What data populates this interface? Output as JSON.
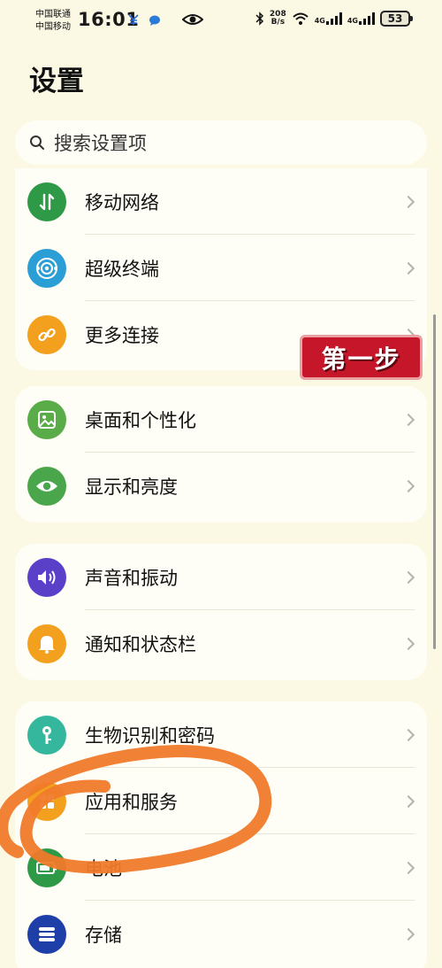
{
  "status_bar": {
    "carrier1": "中国联通",
    "carrier2": "中国移动",
    "time": "16:01",
    "net_speed_value": "208",
    "net_speed_unit": "B/s",
    "signal1_label": "4G",
    "signal2_label": "4G",
    "battery": "53"
  },
  "header": {
    "title": "设置"
  },
  "search": {
    "placeholder": "搜索设置项"
  },
  "groups": [
    {
      "items": [
        {
          "label": "移动网络",
          "icon": "mobile-data-icon",
          "color": "#2e9a48"
        },
        {
          "label": "超级终端",
          "icon": "super-device-icon",
          "color": "#2b9ed6"
        },
        {
          "label": "更多连接",
          "icon": "link-icon",
          "color": "#f2a01e"
        }
      ]
    },
    {
      "items": [
        {
          "label": "桌面和个性化",
          "icon": "wallpaper-icon",
          "color": "#5aac48"
        },
        {
          "label": "显示和亮度",
          "icon": "eye-icon",
          "color": "#4aa64a"
        }
      ]
    },
    {
      "items": [
        {
          "label": "声音和振动",
          "icon": "speaker-icon",
          "color": "#5a3fc9"
        },
        {
          "label": "通知和状态栏",
          "icon": "bell-icon",
          "color": "#f2a01e"
        }
      ]
    },
    {
      "items": [
        {
          "label": "生物识别和密码",
          "icon": "key-icon",
          "color": "#35b79e"
        },
        {
          "label": "应用和服务",
          "icon": "apps-icon",
          "color": "#f2a01e"
        },
        {
          "label": "电池",
          "icon": "battery-icon",
          "color": "#2e9a48"
        },
        {
          "label": "存储",
          "icon": "storage-icon",
          "color": "#1f3fa8"
        }
      ]
    }
  ],
  "annotation": {
    "step_label": "第一步",
    "badge_color": "#c6172a",
    "circle_color": "#f07a2a"
  }
}
